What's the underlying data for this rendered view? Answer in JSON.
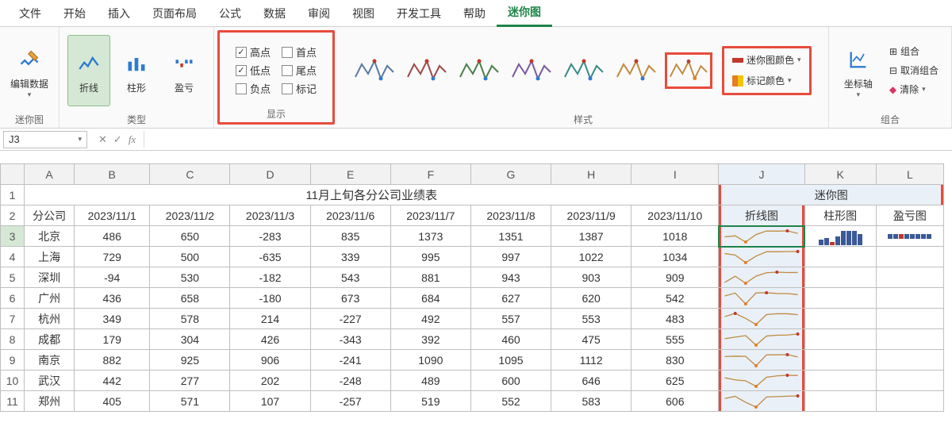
{
  "menu": [
    "文件",
    "开始",
    "插入",
    "页面布局",
    "公式",
    "数据",
    "审阅",
    "视图",
    "开发工具",
    "帮助",
    "迷你图"
  ],
  "menu_active": 10,
  "ribbon": {
    "g1": {
      "edit": "编辑数据",
      "label": "迷你图"
    },
    "g2": {
      "line": "折线",
      "col": "柱形",
      "wl": "盈亏",
      "label": "类型"
    },
    "g3": {
      "opts": [
        [
          "高点",
          true
        ],
        [
          "首点",
          false
        ],
        [
          "低点",
          true
        ],
        [
          "尾点",
          false
        ],
        [
          "负点",
          false
        ],
        [
          "标记",
          false
        ]
      ],
      "label": "显示"
    },
    "g4": {
      "sparkcolor": "迷你图颜色",
      "markcolor": "标记颜色",
      "label": "样式"
    },
    "g5": {
      "axis": "坐标轴",
      "group": "组合",
      "ungroup": "取消组合",
      "clear": "清除",
      "label": "组合"
    }
  },
  "namebox": "J3",
  "cols": [
    "A",
    "B",
    "C",
    "D",
    "E",
    "F",
    "G",
    "H",
    "I",
    "J",
    "K",
    "L"
  ],
  "title": "11月上旬各分公司业绩表",
  "sparktitle": "迷你图",
  "hdr": [
    "分公司",
    "2023/11/1",
    "2023/11/2",
    "2023/11/3",
    "2023/11/6",
    "2023/11/7",
    "2023/11/8",
    "2023/11/9",
    "2023/11/10",
    "折线图",
    "柱形图",
    "盈亏图"
  ],
  "chart_data": {
    "type": "table",
    "columns": [
      "分公司",
      "2023/11/1",
      "2023/11/2",
      "2023/11/3",
      "2023/11/6",
      "2023/11/7",
      "2023/11/8",
      "2023/11/9",
      "2023/11/10"
    ],
    "rows": [
      [
        "北京",
        486,
        650,
        -283,
        835,
        1373,
        1351,
        1387,
        1018
      ],
      [
        "上海",
        729,
        500,
        -635,
        339,
        995,
        997,
        1022,
        1034
      ],
      [
        "深圳",
        -94,
        530,
        -182,
        543,
        881,
        943,
        903,
        909
      ],
      [
        "广州",
        436,
        658,
        -180,
        673,
        684,
        627,
        620,
        542
      ],
      [
        "杭州",
        349,
        578,
        214,
        -227,
        492,
        557,
        553,
        483
      ],
      [
        "成都",
        179,
        304,
        426,
        -343,
        392,
        460,
        475,
        555
      ],
      [
        "南京",
        882,
        925,
        906,
        -241,
        1090,
        1095,
        1112,
        830
      ],
      [
        "武汉",
        442,
        277,
        202,
        -248,
        489,
        600,
        646,
        625
      ],
      [
        "郑州",
        405,
        571,
        107,
        -257,
        519,
        552,
        583,
        606
      ]
    ]
  }
}
